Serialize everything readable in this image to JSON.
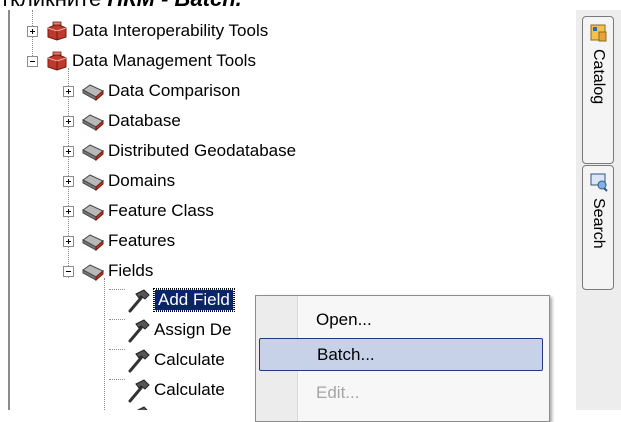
{
  "heading": {
    "prefix": "ткликните",
    "bold_part": "ПКМ - Batch."
  },
  "tree": {
    "items": [
      {
        "label": "Data Interoperability Tools",
        "expander": "+"
      },
      {
        "label": "Data Management Tools",
        "expander": "-"
      },
      {
        "label": "Data Comparison",
        "expander": "+"
      },
      {
        "label": "Database",
        "expander": "+"
      },
      {
        "label": "Distributed Geodatabase",
        "expander": "+"
      },
      {
        "label": "Domains",
        "expander": "+"
      },
      {
        "label": "Feature Class",
        "expander": "+"
      },
      {
        "label": "Features",
        "expander": "+"
      },
      {
        "label": "Fields",
        "expander": "-"
      },
      {
        "label": "Add Field"
      },
      {
        "label": "Assign De"
      },
      {
        "label": "Calculate"
      },
      {
        "label": "Calculate"
      }
    ]
  },
  "dock": {
    "tabs": [
      {
        "label": "Catalog",
        "icon": "catalog-icon"
      },
      {
        "label": "Search",
        "icon": "search-icon"
      }
    ]
  },
  "context_menu": {
    "items": [
      {
        "label": "Open...",
        "state": "normal"
      },
      {
        "label": "Batch...",
        "state": "hover"
      },
      {
        "label": "Edit...",
        "state": "disabled"
      }
    ]
  },
  "colors": {
    "selection": "#0a246a",
    "menu_hover": "#c7d2e8",
    "toolbox_red": "#c0392b"
  }
}
